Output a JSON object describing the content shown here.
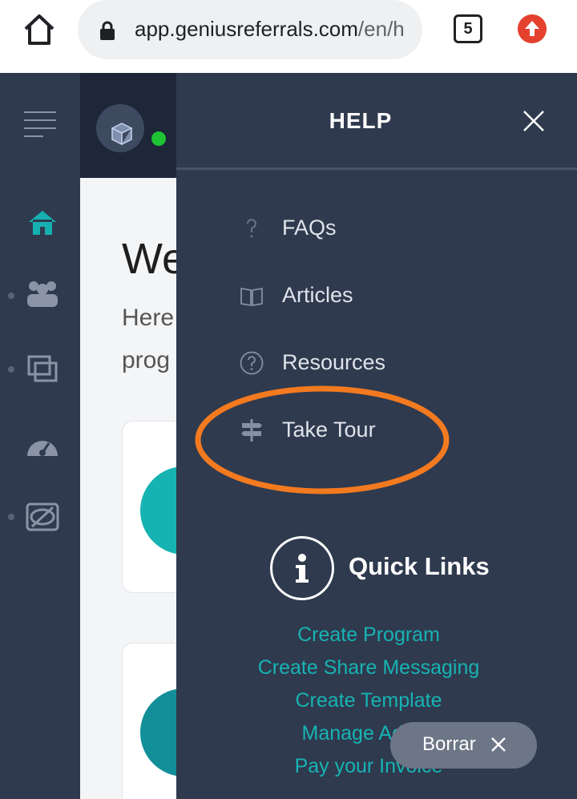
{
  "browser": {
    "url_host": "app.geniusreferrals.com",
    "url_path": "/en/h",
    "tab_count": "5"
  },
  "main": {
    "welcome": "We",
    "intro_line1": "Here",
    "intro_line2": "prog"
  },
  "help": {
    "title": "HELP",
    "items": [
      {
        "label": "FAQs",
        "icon": "question-mark-icon"
      },
      {
        "label": "Articles",
        "icon": "book-icon"
      },
      {
        "label": "Resources",
        "icon": "question-circle-icon"
      },
      {
        "label": "Take Tour",
        "icon": "signpost-icon"
      }
    ],
    "quick_links_title": "Quick Links",
    "quick_links": [
      "Create Program",
      "Create Share Messaging",
      "Create Template",
      "Manage Adv",
      "Pay your Invoice"
    ]
  },
  "toast": {
    "label": "Borrar"
  },
  "colors": {
    "panel_bg": "#2f3a4e",
    "accent_teal": "#17b3b3",
    "annotation": "#f47a20",
    "online": "#1fc232"
  }
}
